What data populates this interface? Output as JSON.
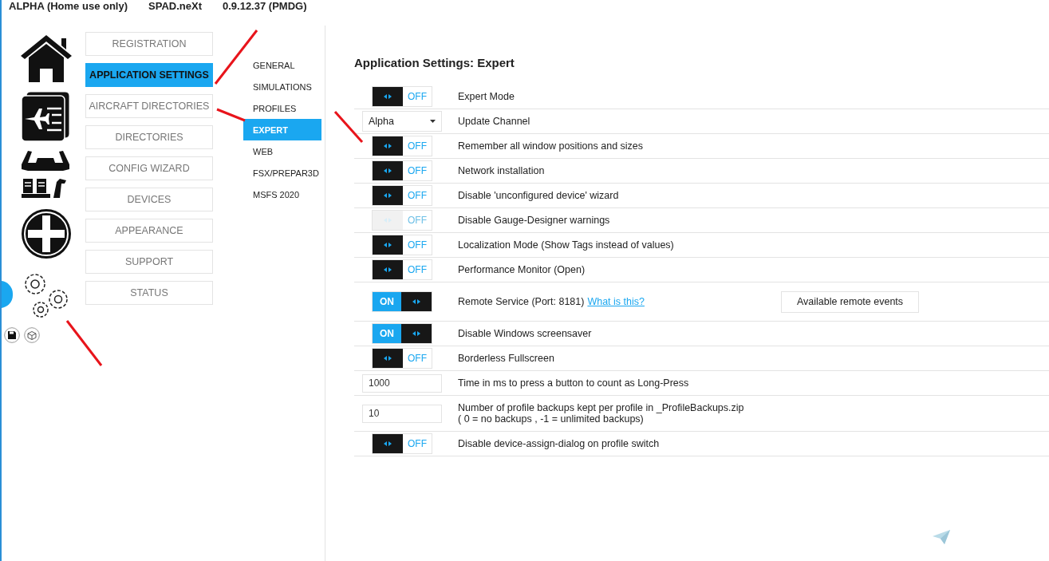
{
  "header": {
    "edition": "ALPHA (Home use only)",
    "product": "SPAD.neXt",
    "version": "0.9.12.37 (PMDG)"
  },
  "main_nav": [
    {
      "label": "REGISTRATION",
      "selected": false
    },
    {
      "label": "APPLICATION SETTINGS",
      "selected": true
    },
    {
      "label": "AIRCRAFT DIRECTORIES",
      "selected": false
    },
    {
      "label": "DIRECTORIES",
      "selected": false
    },
    {
      "label": "CONFIG WIZARD",
      "selected": false
    },
    {
      "label": "DEVICES",
      "selected": false
    },
    {
      "label": "APPEARANCE",
      "selected": false
    },
    {
      "label": "SUPPORT",
      "selected": false
    },
    {
      "label": "STATUS",
      "selected": false
    }
  ],
  "sub_nav": [
    {
      "label": "GENERAL",
      "selected": false
    },
    {
      "label": "SIMULATIONS",
      "selected": false
    },
    {
      "label": "PROFILES",
      "selected": false
    },
    {
      "label": "EXPERT",
      "selected": true
    },
    {
      "label": "WEB",
      "selected": false
    },
    {
      "label": "FSX/PREPAR3D",
      "selected": false
    },
    {
      "label": "MSFS 2020",
      "selected": false
    }
  ],
  "page_title": "Application Settings: Expert",
  "settings": [
    {
      "kind": "toggle",
      "on": false,
      "disabled": false,
      "state_text": "OFF",
      "label": "Expert Mode"
    },
    {
      "kind": "select",
      "value": "Alpha",
      "label": "Update Channel"
    },
    {
      "kind": "toggle",
      "on": false,
      "disabled": false,
      "state_text": "OFF",
      "label": "Remember all window positions and sizes"
    },
    {
      "kind": "toggle",
      "on": false,
      "disabled": false,
      "state_text": "OFF",
      "label": "Network installation"
    },
    {
      "kind": "toggle",
      "on": false,
      "disabled": false,
      "state_text": "OFF",
      "label": "Disable 'unconfigured device' wizard"
    },
    {
      "kind": "toggle",
      "on": false,
      "disabled": true,
      "state_text": "OFF",
      "label": "Disable Gauge-Designer warnings"
    },
    {
      "kind": "toggle",
      "on": false,
      "disabled": false,
      "state_text": "OFF",
      "label": "Localization Mode (Show Tags instead of values)"
    },
    {
      "kind": "toggle",
      "on": false,
      "disabled": false,
      "state_text": "OFF",
      "label": "Performance Monitor (Open)"
    },
    {
      "kind": "toggle",
      "on": true,
      "disabled": false,
      "state_text": "ON",
      "label": "Remote Service (Port: 8181)",
      "link": "What is this?",
      "button": "Available remote events"
    },
    {
      "kind": "toggle",
      "on": true,
      "disabled": false,
      "state_text": "ON",
      "label": "Disable Windows screensaver"
    },
    {
      "kind": "toggle",
      "on": false,
      "disabled": false,
      "state_text": "OFF",
      "label": "Borderless Fullscreen"
    },
    {
      "kind": "number",
      "value": "1000",
      "label": "Time in ms to press a button to count as Long-Press"
    },
    {
      "kind": "number",
      "value": "10",
      "label": "Number of profile backups kept per profile in _ProfileBackups.zip",
      "note": "( 0 = no backups , -1 = unlimited backups)"
    },
    {
      "kind": "toggle",
      "on": false,
      "disabled": false,
      "state_text": "OFF",
      "label": "Disable device-assign-dialog on profile switch"
    }
  ]
}
